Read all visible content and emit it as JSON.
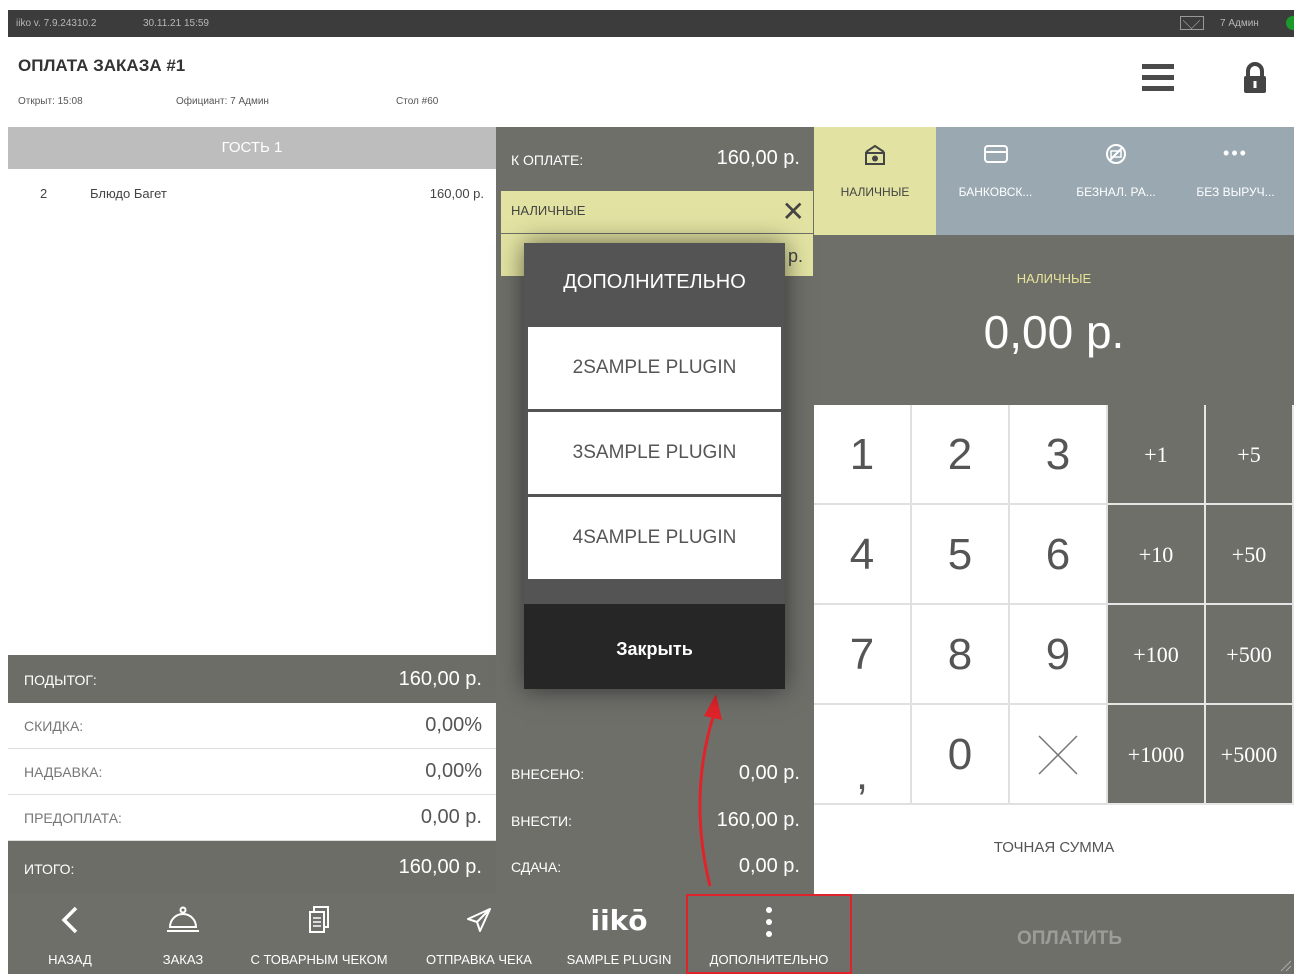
{
  "statusbar": {
    "version": "iiko v. 7.9.24310.2",
    "datetime": "30.11.21  15:59",
    "user": "7 Админ"
  },
  "header": {
    "title": "ОПЛАТА ЗАКАЗА #1",
    "opened": "Открыт: 15:08",
    "waiter": "Официант: 7 Админ",
    "table": "Стол #60"
  },
  "order": {
    "guest_label": "ГОСТЬ 1",
    "items": [
      {
        "qty": "2",
        "name": "Блюдо Багет",
        "price": "160,00 р."
      }
    ],
    "subtotal_label": "ПОДЫТОГ:",
    "subtotal_value": "160,00 р.",
    "discount_label": "СКИДКА:",
    "discount_value": "0,00%",
    "surcharge_label": "НАДБАВКА:",
    "surcharge_value": "0,00%",
    "prepay_label": "ПРЕДОПЛАТА:",
    "prepay_value": "0,00 р.",
    "total_label": "ИТОГО:",
    "total_value": "160,00 р."
  },
  "payment": {
    "to_pay_label": "К ОПЛАТЕ:",
    "to_pay_value": "160,00 р.",
    "line_label": "НАЛИЧНЫЕ",
    "line_value_fragment": "р.",
    "paid_label": "ВНЕСЕНО:",
    "paid_value": "0,00 р.",
    "due_label": "ВНЕСТИ:",
    "due_value": "160,00 р.",
    "change_label": "СДАЧА:",
    "change_value": "0,00 р."
  },
  "payment_types": [
    {
      "label": "НАЛИЧНЫЕ",
      "icon": "cash-icon",
      "active": true
    },
    {
      "label": "БАНКОВСК...",
      "icon": "card-icon",
      "active": false
    },
    {
      "label": "БЕЗНАЛ. РА...",
      "icon": "cashless-icon",
      "active": false
    },
    {
      "label": "БЕЗ ВЫРУЧ...",
      "icon": "more-dots-icon",
      "active": false
    }
  ],
  "entry": {
    "label": "НАЛИЧНЫЕ",
    "amount": "0,00 р."
  },
  "keypad": {
    "digits": [
      "1",
      "2",
      "3",
      "4",
      "5",
      "6",
      "7",
      "8",
      "9",
      ",",
      "0"
    ],
    "increments": [
      "+1",
      "+5",
      "+10",
      "+50",
      "+100",
      "+500",
      "+1000",
      "+5000"
    ],
    "exact_label": "ТОЧНАЯ СУММА"
  },
  "modal": {
    "title": "ДОПОЛНИТЕЛЬНО",
    "items": [
      "2SAMPLE PLUGIN",
      "3SAMPLE PLUGIN",
      "4SAMPLE PLUGIN"
    ],
    "close_label": "Закрыть"
  },
  "toolbar": {
    "back": "НАЗАД",
    "order": "ЗАКАЗ",
    "receipt": "С ТОВАРНЫМ ЧЕКОМ",
    "send": "ОТПРАВКА ЧЕКА",
    "plugin_logo": "iikō",
    "plugin": "SAMPLE PLUGIN",
    "more": "ДОПОЛНИТЕЛЬНО",
    "pay": "ОПЛАТИТЬ"
  },
  "colors": {
    "accent_cash": "#e2e3a2",
    "panel_gray": "#6f6f6a",
    "highlight_red": "#e0232a",
    "status_green": "#1b9a2b"
  }
}
